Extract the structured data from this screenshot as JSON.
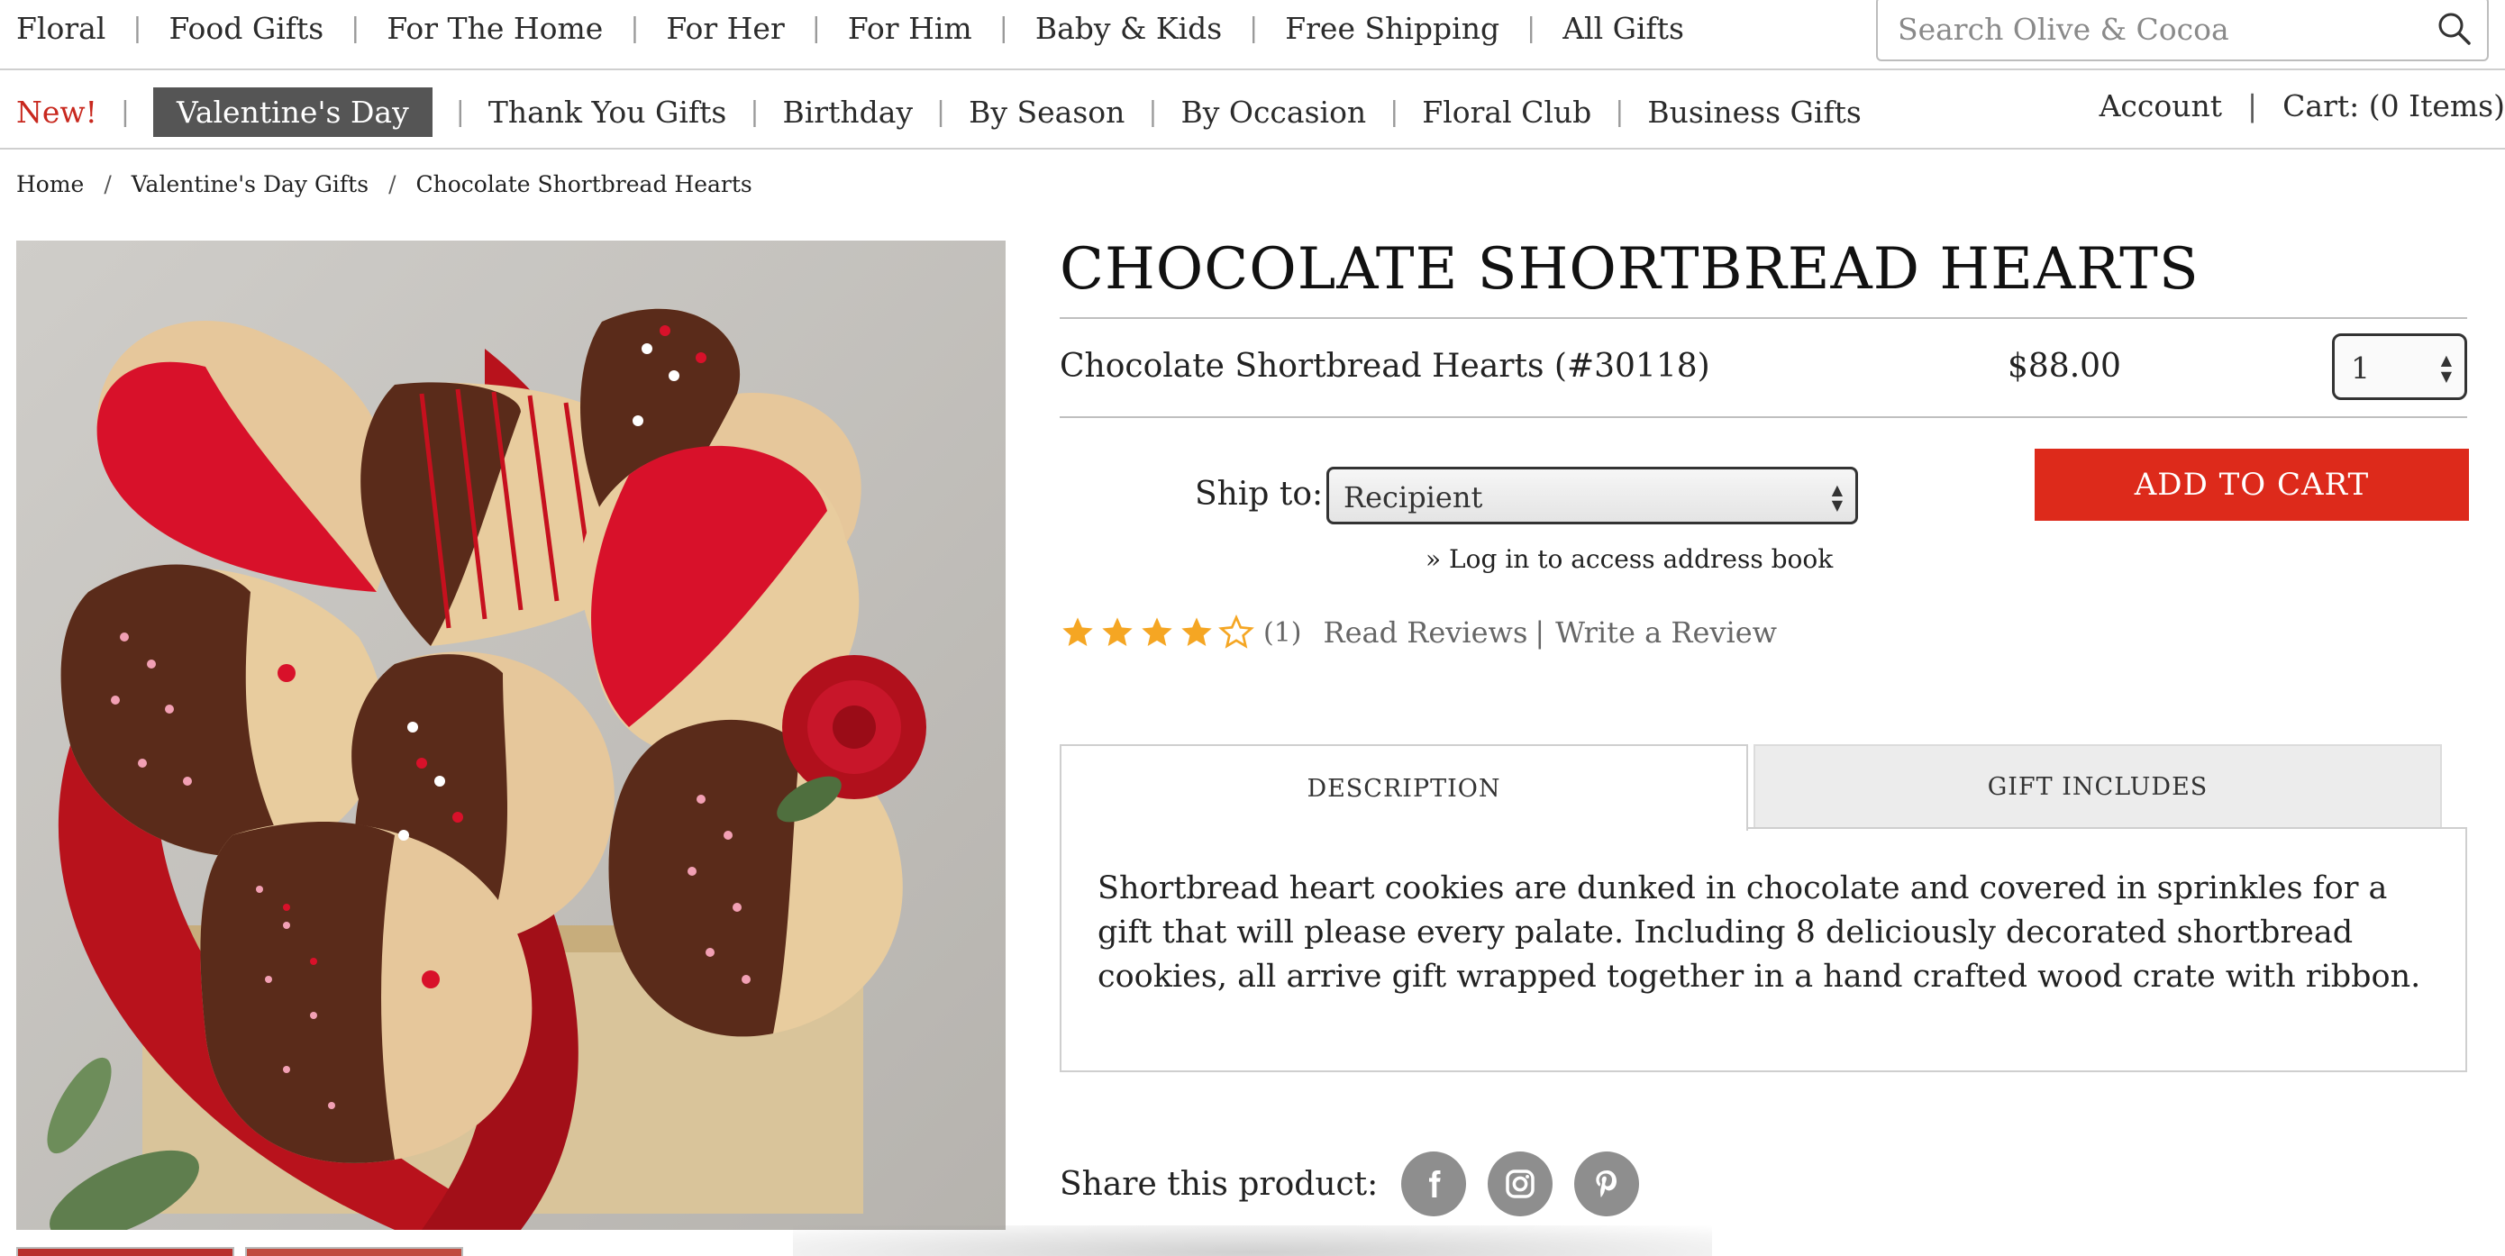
{
  "top_nav": {
    "items": [
      {
        "label": "Floral"
      },
      {
        "label": "Food Gifts"
      },
      {
        "label": "For The Home"
      },
      {
        "label": "For Her"
      },
      {
        "label": "For Him"
      },
      {
        "label": "Baby & Kids"
      },
      {
        "label": "Free Shipping"
      },
      {
        "label": "All Gifts"
      }
    ],
    "search_placeholder": "Search Olive & Cocoa",
    "search_icon": "search-icon"
  },
  "sub_nav": {
    "items": [
      {
        "label": "New!"
      },
      {
        "label": "Valentine's Day"
      },
      {
        "label": "Thank You Gifts"
      },
      {
        "label": "Birthday"
      },
      {
        "label": "By Season"
      },
      {
        "label": "By Occasion"
      },
      {
        "label": "Floral Club"
      },
      {
        "label": "Business Gifts"
      }
    ],
    "active_index": 1,
    "new_color": "#c8281e",
    "active_bg": "#555555",
    "account": "Account",
    "separator": "|",
    "cart": "Cart: (0 Items)"
  },
  "breadcrumb": {
    "items": [
      "Home",
      "Valentine's Day Gifts",
      "Chocolate Shortbread Hearts"
    ],
    "separator": "/"
  },
  "product": {
    "title": "CHOCOLATE SHORTBREAD HEARTS",
    "item_name": "Chocolate Shortbread Hearts (#30118)",
    "price": "$88.00",
    "quantity": "1",
    "ship_to_label": "Ship to:",
    "ship_to_value": "Recipient",
    "address_book_arrow": "»",
    "address_book_link": "Log in to access address book",
    "add_to_cart": "ADD TO CART",
    "add_to_cart_color": "#dd2a1b"
  },
  "rating": {
    "value": 4,
    "max": 5,
    "star_color": "#f5a623",
    "count": "(1)",
    "read_reviews": "Read Reviews",
    "separator": "|",
    "write_review": "Write a Review"
  },
  "tabs": {
    "items": [
      {
        "label": "DESCRIPTION",
        "active": true
      },
      {
        "label": "GIFT INCLUDES",
        "active": false
      }
    ],
    "description": "Shortbread heart cookies are dunked in chocolate and covered in sprinkles for a gift that will please every palate. Including 8 deliciously decorated shortbread cookies, all arrive gift wrapped together in a hand crafted wood crate with ribbon."
  },
  "share": {
    "label": "Share this product:",
    "icons": [
      "facebook-icon",
      "instagram-icon",
      "pinterest-icon"
    ]
  }
}
